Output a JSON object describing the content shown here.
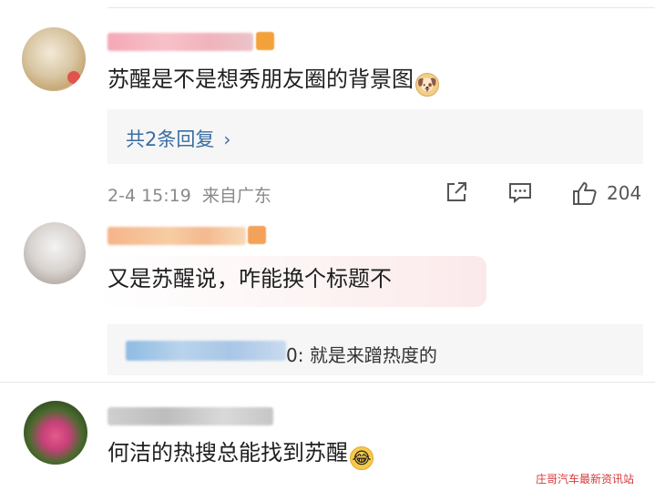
{
  "comments": [
    {
      "text": "苏醒是不是想秀朋友圈的背景图",
      "emoji": "doge-emoji",
      "replies_link": "共2条回复",
      "time": "2-4 15:19",
      "location": "来自广东",
      "likes": "204"
    },
    {
      "text": "又是苏醒说，咋能换个标题不",
      "subreply": {
        "suffix": "0: 就是来蹭热度的"
      }
    },
    {
      "text": "何洁的热搜总能找到苏醒",
      "emoji": "laughing-crying-emoji"
    }
  ],
  "icons": {
    "chevron": "chevron-right-icon",
    "share": "share-icon",
    "comment": "comment-icon",
    "like": "thumbs-up-icon"
  },
  "colors": {
    "link": "#3a6da3",
    "meta": "#8a8a8a",
    "watermark": "#d63a3a"
  },
  "watermark": "庄哥汽车最新资讯站"
}
